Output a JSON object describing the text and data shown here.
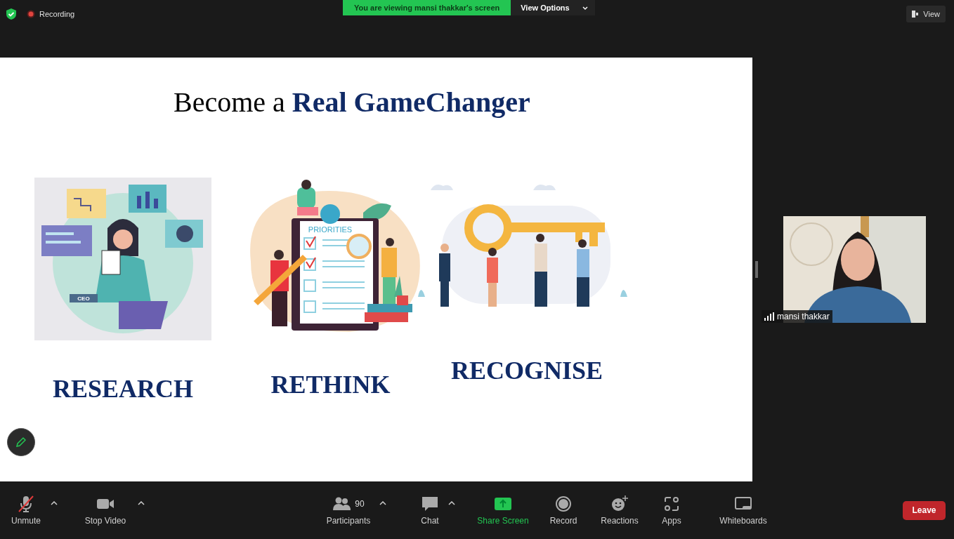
{
  "top_bar": {
    "recording": {
      "label": "Recording",
      "on": true
    },
    "banner": {
      "text": "You are viewing mansi thakkar's screen",
      "view_options": "View Options"
    },
    "view": "View"
  },
  "slide": {
    "title": "Become a **Real GameChanger**",
    "columns": [
      {
        "kind": "research",
        "label": "RESEARCH",
        "tag": "CEO"
      },
      {
        "kind": "rethink",
        "label": "RETHINK",
        "tag": "PRIORITIES"
      },
      {
        "kind": "recognise",
        "label": "RECOGNISE"
      }
    ]
  },
  "video": {
    "name": "mansi thakkar"
  },
  "toolbar": {
    "items": [
      {
        "kind": "mic",
        "label": "Unmute",
        "muted": true,
        "caret": true
      },
      {
        "kind": "video",
        "label": "Stop Video",
        "caret": true
      },
      {
        "kind": "participants",
        "label": "Participants",
        "count": "90",
        "caret": true
      },
      {
        "kind": "chat",
        "label": "Chat",
        "caret": true
      },
      {
        "kind": "share",
        "label": "Share Screen",
        "caret": false
      },
      {
        "kind": "record",
        "label": "Record",
        "caret": false
      },
      {
        "kind": "reactions",
        "label": "Reactions",
        "caret": false
      },
      {
        "kind": "apps",
        "label": "Apps",
        "caret": false
      },
      {
        "kind": "whiteboards",
        "label": "Whiteboards",
        "caret": false
      }
    ],
    "leave": "Leave"
  }
}
